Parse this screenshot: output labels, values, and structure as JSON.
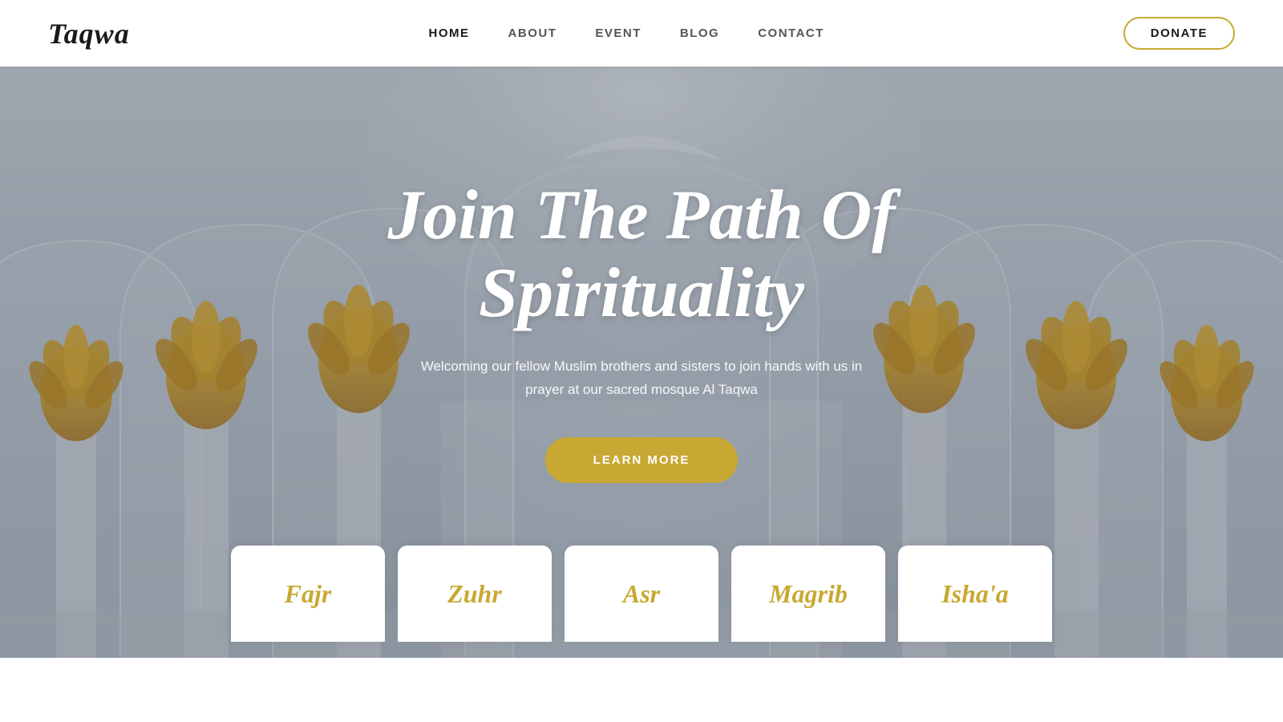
{
  "brand": {
    "logo": "Taqwa"
  },
  "navbar": {
    "links": [
      {
        "label": "HOME",
        "active": true
      },
      {
        "label": "ABOUT",
        "active": false
      },
      {
        "label": "EVENT",
        "active": false
      },
      {
        "label": "BLOG",
        "active": false
      },
      {
        "label": "CONTACT",
        "active": false
      }
    ],
    "donate_label": "DONATE"
  },
  "hero": {
    "title_line1": "Join The Path Of",
    "title_line2": "Spirituality",
    "subtitle": "Welcoming our fellow Muslim brothers and sisters to join hands with us in prayer at our sacred mosque Al Taqwa",
    "cta_label": "LEARN MORE"
  },
  "prayer_times": [
    {
      "name": "Fajr"
    },
    {
      "name": "Zuhr"
    },
    {
      "name": "Asr"
    },
    {
      "name": "Magrib"
    },
    {
      "name": "Isha'a"
    }
  ],
  "colors": {
    "gold": "#c8a832",
    "white": "#ffffff",
    "dark": "#1a1a1a"
  }
}
